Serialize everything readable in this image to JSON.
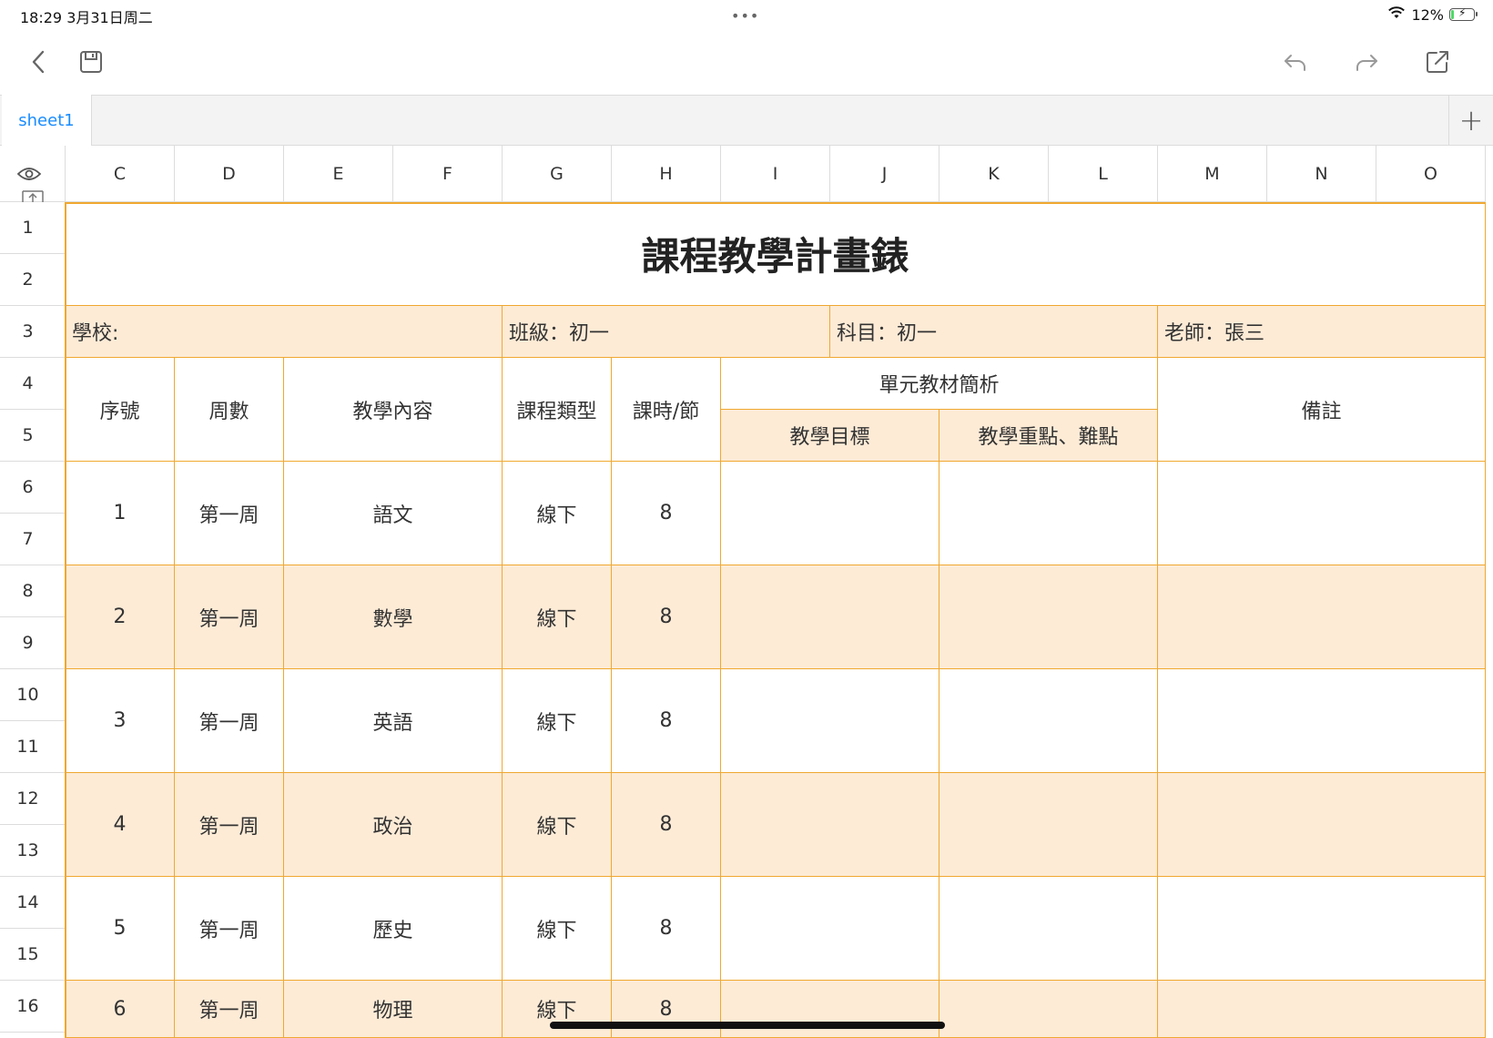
{
  "status_bar": {
    "time_date": "18:29   3月31日周二",
    "dots": "•••",
    "battery_percent": "12%",
    "battery_level": 0.12
  },
  "toolbar": {
    "back_icon": "chevron-left-icon",
    "save_icon": "save-icon",
    "undo_icon": "undo-icon",
    "redo_icon": "redo-icon",
    "share_icon": "share-icon"
  },
  "tabs": {
    "sheets": [
      "sheet1"
    ],
    "add_label": "+"
  },
  "grid": {
    "columns": [
      "C",
      "D",
      "E",
      "F",
      "G",
      "H",
      "I",
      "J",
      "K",
      "L",
      "M",
      "N",
      "O"
    ],
    "rows": [
      "1",
      "2",
      "3",
      "4",
      "5",
      "6",
      "7",
      "8",
      "9",
      "10",
      "11",
      "12",
      "13",
      "14",
      "15",
      "16"
    ],
    "accent_color": "#f0a830",
    "band_color": "#fdebd6"
  },
  "sheet": {
    "title": "課程教學計畫錶",
    "info": {
      "school": "學校:",
      "class": "班級：初一",
      "subject": "科目：初一",
      "teacher": "老師：張三"
    },
    "headers": {
      "index": "序號",
      "week": "周數",
      "content": "教學內容",
      "type": "課程類型",
      "hours": "課時/節",
      "unit_analysis": "單元教材簡析",
      "goals": "教學目標",
      "key_points": "教學重點、難點",
      "notes": "備註"
    },
    "rows": [
      {
        "index": "1",
        "week": "第一周",
        "content": "語文",
        "type": "線下",
        "hours": "8"
      },
      {
        "index": "2",
        "week": "第一周",
        "content": "數學",
        "type": "線下",
        "hours": "8"
      },
      {
        "index": "3",
        "week": "第一周",
        "content": "英語",
        "type": "線下",
        "hours": "8"
      },
      {
        "index": "4",
        "week": "第一周",
        "content": "政治",
        "type": "線下",
        "hours": "8"
      },
      {
        "index": "5",
        "week": "第一周",
        "content": "歷史",
        "type": "線下",
        "hours": "8"
      },
      {
        "index": "6",
        "week": "第一周",
        "content": "物理",
        "type": "線下",
        "hours": "8"
      }
    ]
  }
}
